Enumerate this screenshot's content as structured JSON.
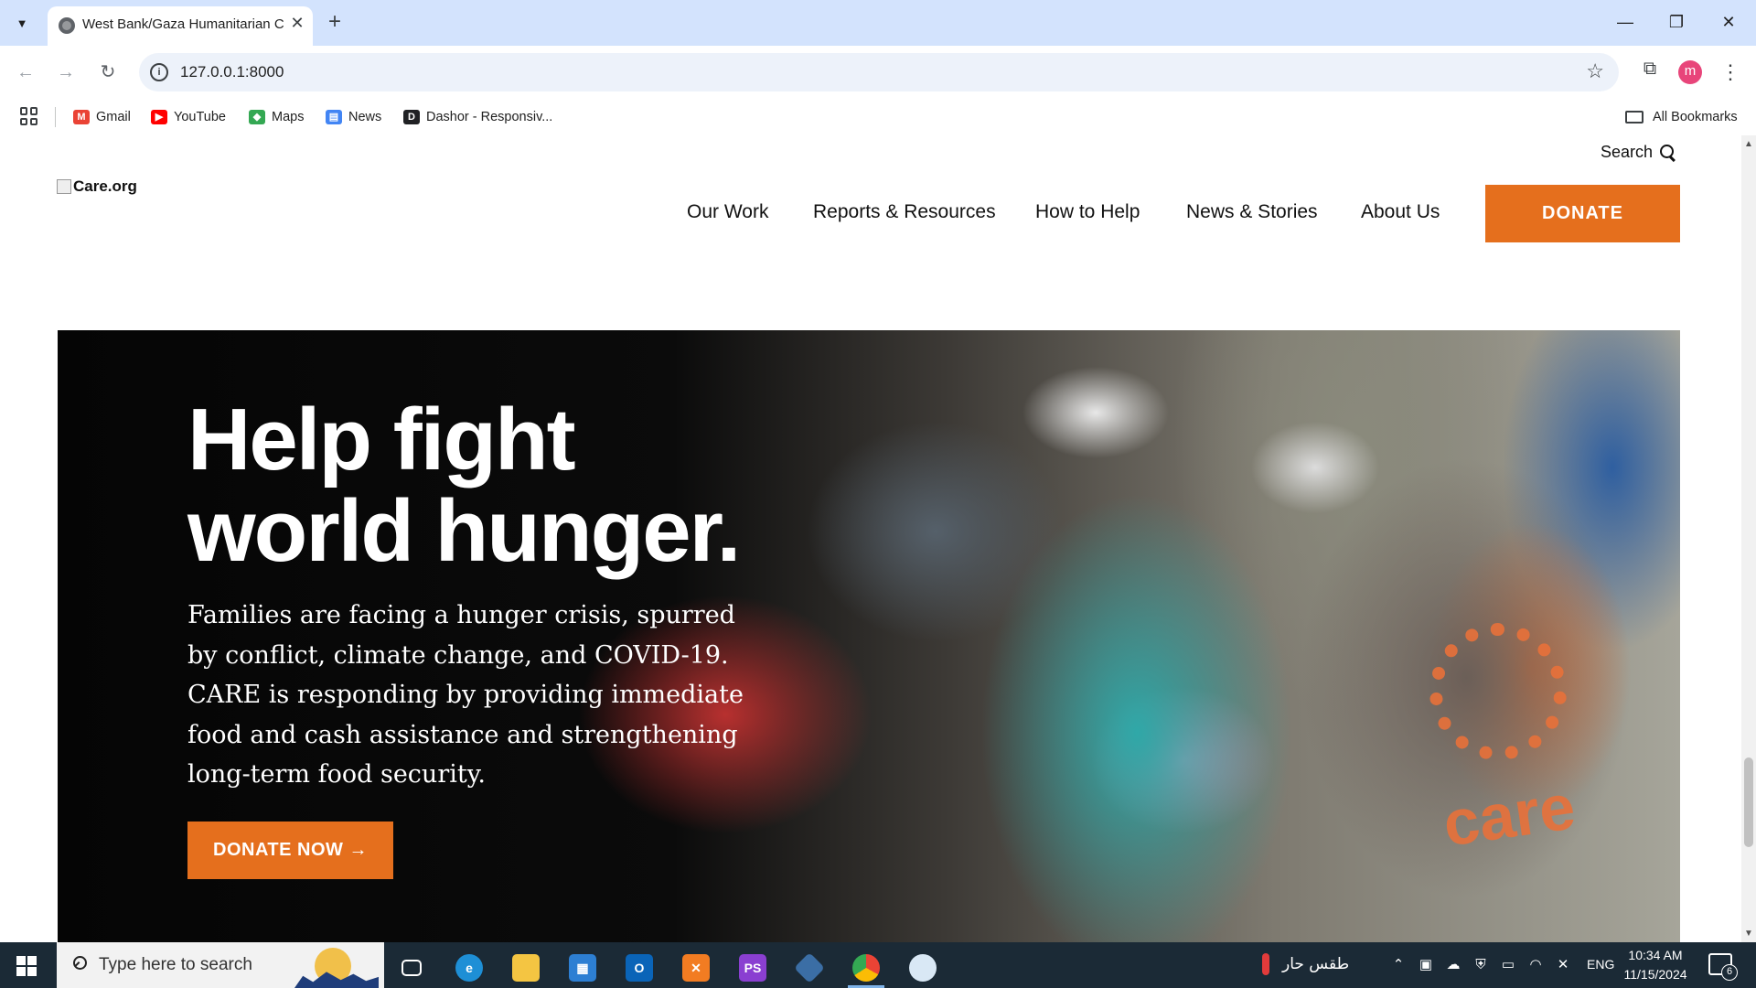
{
  "browser": {
    "tab_title": "West Bank/Gaza Humanitarian C",
    "tab_close": "✕",
    "new_tab": "+",
    "url": "127.0.0.1:8000",
    "profile_initial": "m",
    "window_controls": {
      "minimize": "—",
      "maximize": "❐",
      "close": "✕"
    }
  },
  "bookmarks": {
    "items": [
      {
        "label": "Gmail",
        "icon": "gmail-icon",
        "color": "#ea4335"
      },
      {
        "label": "YouTube",
        "icon": "youtube-icon",
        "color": "#ff0000"
      },
      {
        "label": "Maps",
        "icon": "maps-icon",
        "color": "#34a853"
      },
      {
        "label": "News",
        "icon": "news-icon",
        "color": "#4285f4"
      },
      {
        "label": "Dashor - Responsiv...",
        "icon": "dashor-icon",
        "color": "#202124"
      }
    ],
    "all_bookmarks": "All Bookmarks"
  },
  "site": {
    "search_label": "Search",
    "logo_alt": "Care.org",
    "nav": [
      "Our Work",
      "Reports & Resources",
      "How to Help",
      "News & Stories",
      "About Us"
    ],
    "donate_label": "DONATE",
    "accent_color": "#e56f1d",
    "hero": {
      "title_line1": "Help fight",
      "title_line2": "world hunger.",
      "body": "Families are facing a hunger crisis, spurred by conflict, climate change, and COVID-19. CARE is responding by providing immediate food and cash assistance and strengthening long-term food security.",
      "cta_label": "DONATE NOW →",
      "vest_logo_text": "care"
    }
  },
  "taskbar": {
    "search_placeholder": "Type here to search",
    "apps": [
      "task-view",
      "edge",
      "file-explorer",
      "microsoft-store",
      "outlook",
      "xampp",
      "phpstorm",
      "git",
      "chrome",
      "paint"
    ],
    "weather_text": "طقس حار",
    "language": "ENG",
    "time": "10:34 AM",
    "date": "11/15/2024",
    "notification_count": "6"
  }
}
